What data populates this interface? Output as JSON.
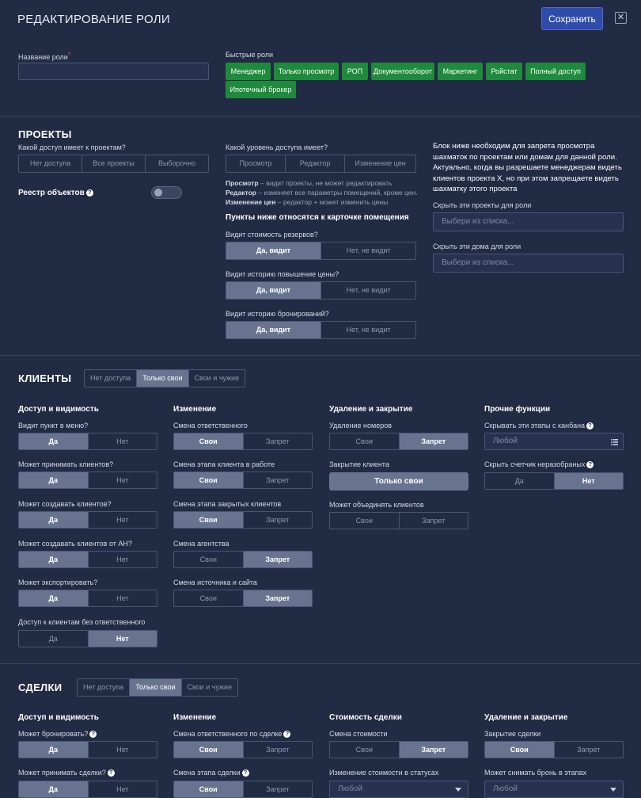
{
  "header": {
    "title": "РЕДАКТИРОВАНИЕ РОЛИ",
    "save_label": "Сохранить",
    "close_glyph": "✕"
  },
  "role": {
    "name_label": "Название роли",
    "required_mark": "*",
    "name_value": "",
    "quick_label": "Быстрые роли",
    "quick_roles": [
      "Менеджер",
      "Только просмотр",
      "РОП",
      "Документооборот",
      "Маркетинг",
      "Ройстат",
      "Полный доступ",
      "Ипотечный брокер"
    ]
  },
  "projects": {
    "title": "ПРОЕКТЫ",
    "access_q": "Какой доступ имеет к проектам?",
    "access_options": [
      "Нет доступа",
      "Все проекты",
      "Выборочно"
    ],
    "registry_label": "Реестр объектов",
    "level_q": "Какой уровень доступа имеет?",
    "level_options": [
      "Просмотр",
      "Редактор",
      "Изменение цен"
    ],
    "help": [
      {
        "term": "Просмотр",
        "text": " – видит проекты, не может редактировать"
      },
      {
        "term": "Редактор",
        "text": " – изменяет все параметры помещений, кроме цен."
      },
      {
        "term": "Изменение цен",
        "text": " – редактор + может изменить цены"
      }
    ],
    "card_title": "Пункты ниже относятся к карточке помещения",
    "card_questions": [
      {
        "label": "Видит стоимость резервов?",
        "yes": "Да, видит",
        "no": "Нет, не видит"
      },
      {
        "label": "Видит историю повышение цены?",
        "yes": "Да, видит",
        "no": "Нет, не видит"
      },
      {
        "label": "Видит историю бронирований?",
        "yes": "Да, видит",
        "no": "Нет, не видит"
      }
    ],
    "info": "Блок ниже необходим для запрета просмотра шахматок по проектам или домам для данной роли. Актуально, когда вы разрешаете менеджерам видеть клиентов проекта X, но при этом запрещаете видеть шахматку этого проекта",
    "hide_projects_label": "Скрыть эти проекты для роли",
    "hide_projects_placeholder": "Выбери из списка...",
    "hide_houses_label": "Скрыть эти дома для роли",
    "hide_houses_placeholder": "Выбери из списка..."
  },
  "clients": {
    "title": "КЛИЕНТЫ",
    "scope": [
      "Нет доступа",
      "Только свои",
      "Свои и чужие"
    ],
    "col1": {
      "title": "Доступ и видимость",
      "items": [
        {
          "label": "Видит пункт в меню?",
          "a": "Да",
          "b": "Нет"
        },
        {
          "label": "Может принимать клиентов?",
          "a": "Да",
          "b": "Нет"
        },
        {
          "label": "Может создавать клиентов?",
          "a": "Да",
          "b": "Нет"
        },
        {
          "label": "Может создавать клиентов от АН?",
          "a": "Да",
          "b": "Нет"
        },
        {
          "label": "Может экспортировать?",
          "a": "Да",
          "b": "Нет"
        },
        {
          "label": "Доступ к клиентам без ответственного",
          "a": "Да",
          "b": "Нет"
        }
      ]
    },
    "col2": {
      "title": "Изменение",
      "items": [
        {
          "label": "Смена ответственного",
          "a": "Свои",
          "b": "Запрет"
        },
        {
          "label": "Смена этапа клиента в работе",
          "a": "Свои",
          "b": "Запрет"
        },
        {
          "label": "Смена этапа закрытых клиентов",
          "a": "Свои",
          "b": "Запрет"
        },
        {
          "label": "Смена агентства",
          "a": "Свои",
          "b": "Запрет"
        },
        {
          "label": "Смена источника и сайта",
          "a": "Свои",
          "b": "Запрет"
        }
      ]
    },
    "col3": {
      "title": "Удаление и закрытие",
      "delete_label": "Удаление номеров",
      "delete_a": "Свои",
      "delete_b": "Запрет",
      "close_label": "Закрытие клиента",
      "close_value": "Только свои",
      "merge_label": "Может объединять клиентов",
      "merge_a": "Свои",
      "merge_b": "Запрет"
    },
    "col4": {
      "title": "Прочие функции",
      "kanban_label": "Скрывать эти этапы с канбана",
      "kanban_placeholder": "Любой",
      "counter_label": "Скрыть счетчик неразобраных",
      "counter_a": "Да",
      "counter_b": "Нет"
    }
  },
  "deals": {
    "title": "СДЕЛКИ",
    "scope": [
      "Нет доступа",
      "Только свои",
      "Свои и чужие"
    ],
    "col1": {
      "title": "Доступ и видимость",
      "q1": "Может бронировать?",
      "q1a": "Да",
      "q1b": "Нет",
      "q2": "Может принимать сделки?",
      "q2a": "Да",
      "q2b": "Нет"
    },
    "col2": {
      "title": "Изменение",
      "q1": "Смена ответственного по сделке",
      "q1a": "Свои",
      "q1b": "Запрет",
      "q2": "Смена этапа сделки",
      "q2a": "Свои",
      "q2b": "Запрет"
    },
    "col3": {
      "title": "Стоимость сделки",
      "q1": "Смена стоимости",
      "q1a": "Свои",
      "q1b": "Запрет",
      "q2": "Изменение стоимости в статусах",
      "q2_placeholder": "Любой"
    },
    "col4": {
      "title": "Удаление и закрытие",
      "q1": "Закрытие сделки",
      "q1a": "Свои",
      "q1b": "Запрет",
      "q2": "Может снимать бронь в этапах",
      "q2_placeholder": "Любой"
    }
  }
}
